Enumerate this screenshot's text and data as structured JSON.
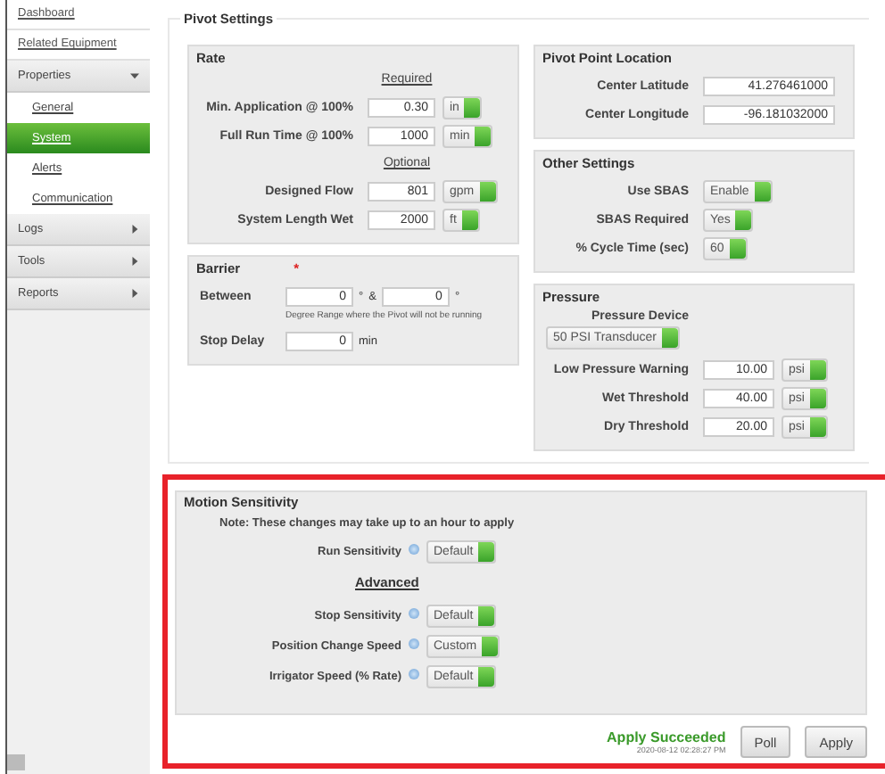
{
  "sidebar": {
    "items": [
      {
        "label": "Dashboard",
        "kind": "link"
      },
      {
        "label": "Related Equipment",
        "kind": "link"
      },
      {
        "label": "Properties",
        "kind": "section",
        "expanded": true
      },
      {
        "label": "General",
        "kind": "subitem",
        "selected": false
      },
      {
        "label": "System",
        "kind": "subitem",
        "selected": true
      },
      {
        "label": "Alerts",
        "kind": "subitem",
        "selected": false
      },
      {
        "label": "Communication",
        "kind": "subitem",
        "selected": false
      },
      {
        "label": "Logs",
        "kind": "section",
        "expanded": false
      },
      {
        "label": "Tools",
        "kind": "section",
        "expanded": false
      },
      {
        "label": "Reports",
        "kind": "section",
        "expanded": false
      }
    ]
  },
  "pivot_settings": {
    "title": "Pivot Settings",
    "rate": {
      "title": "Rate",
      "groups": [
        {
          "heading": "Required",
          "fields": [
            {
              "label": "Min. Application @ 100%",
              "value": "0.30",
              "unit": "in"
            },
            {
              "label": "Full Run Time @ 100%",
              "value": "1000",
              "unit": "min"
            }
          ]
        },
        {
          "heading": "Optional",
          "fields": [
            {
              "label": "Designed Flow",
              "value": "801",
              "unit": "gpm"
            },
            {
              "label": "System Length Wet",
              "value": "2000",
              "unit": "ft"
            }
          ]
        }
      ]
    },
    "barrier": {
      "title": "Barrier",
      "required_mark": "*",
      "between_label": "Between",
      "from": "0",
      "from_suffix": "°",
      "joiner": "&",
      "to": "0",
      "to_suffix": "°",
      "hint": "Degree Range where the Pivot will not be running",
      "stop_delay_label": "Stop Delay",
      "stop_delay": "0",
      "stop_delay_unit": "min"
    },
    "pivot_point": {
      "title": "Pivot Point Location",
      "fields": [
        {
          "label": "Center Latitude",
          "value": "41.276461000"
        },
        {
          "label": "Center Longitude",
          "value": "-96.181032000"
        }
      ]
    },
    "other": {
      "title": "Other Settings",
      "fields": [
        {
          "label": "Use SBAS",
          "value": "Enable"
        },
        {
          "label": "SBAS Required",
          "value": "Yes"
        },
        {
          "label": "% Cycle Time (sec)",
          "value": "60"
        }
      ]
    },
    "pressure": {
      "title": "Pressure",
      "device_label": "Pressure Device",
      "device": "50 PSI Transducer",
      "fields": [
        {
          "label": "Low Pressure Warning",
          "value": "10.00",
          "unit": "psi"
        },
        {
          "label": "Wet Threshold",
          "value": "40.00",
          "unit": "psi"
        },
        {
          "label": "Dry Threshold",
          "value": "20.00",
          "unit": "psi"
        }
      ]
    }
  },
  "motion_sensitivity": {
    "title": "Motion Sensitivity",
    "note": "Note: These changes may take up to an hour to apply",
    "run": {
      "label": "Run Sensitivity",
      "value": "Default"
    },
    "advanced_heading": "Advanced",
    "advanced": [
      {
        "label": "Stop Sensitivity",
        "value": "Default"
      },
      {
        "label": "Position Change Speed",
        "value": "Custom"
      },
      {
        "label": "Irrigator Speed (% Rate)",
        "value": "Default"
      }
    ]
  },
  "footer": {
    "status": "Apply Succeeded",
    "timestamp": "2020-08-12 02:28:27 PM",
    "buttons": [
      "Poll",
      "Apply"
    ]
  }
}
